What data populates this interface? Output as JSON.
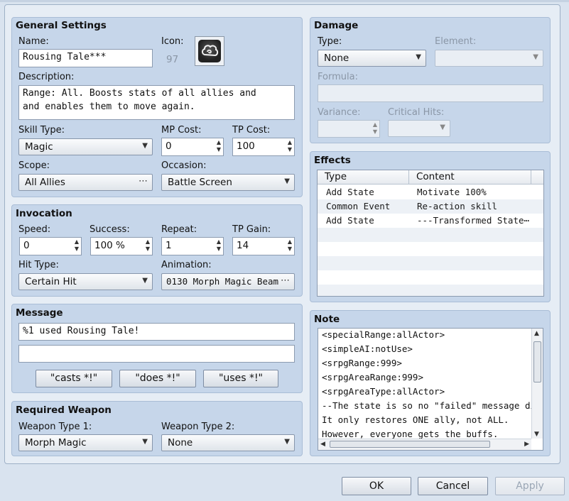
{
  "general": {
    "title": "General Settings",
    "name_label": "Name:",
    "name_value": "Rousing Tale***",
    "icon_label": "Icon:",
    "icon_index": "97",
    "icon_name": "swirl-cloud-icon",
    "description_label": "Description:",
    "description_line1": "Range: All. Boosts stats of all allies and",
    "description_line2": "and enables them to move again.",
    "skill_type_label": "Skill Type:",
    "skill_type_value": "Magic",
    "mp_cost_label": "MP Cost:",
    "mp_cost_value": "0",
    "tp_cost_label": "TP Cost:",
    "tp_cost_value": "100",
    "scope_label": "Scope:",
    "scope_value": "All Allies",
    "occasion_label": "Occasion:",
    "occasion_value": "Battle Screen"
  },
  "invocation": {
    "title": "Invocation",
    "speed_label": "Speed:",
    "speed_value": "0",
    "success_label": "Success:",
    "success_value": "100 %",
    "repeat_label": "Repeat:",
    "repeat_value": "1",
    "tp_gain_label": "TP Gain:",
    "tp_gain_value": "14",
    "hit_type_label": "Hit Type:",
    "hit_type_value": "Certain Hit",
    "animation_label": "Animation:",
    "animation_value": "0130 Morph Magic Beam"
  },
  "message": {
    "title": "Message",
    "line1": "%1 used Rousing Tale!",
    "line2": "",
    "btn_casts": "\"casts *!\"",
    "btn_does": "\"does *!\"",
    "btn_uses": "\"uses *!\""
  },
  "required_weapon": {
    "title": "Required Weapon",
    "type1_label": "Weapon Type 1:",
    "type1_value": "Morph Magic",
    "type2_label": "Weapon Type 2:",
    "type2_value": "None"
  },
  "damage": {
    "title": "Damage",
    "type_label": "Type:",
    "type_value": "None",
    "element_label": "Element:",
    "element_value": "",
    "formula_label": "Formula:",
    "formula_value": "",
    "variance_label": "Variance:",
    "variance_value": "",
    "critical_label": "Critical Hits:",
    "critical_value": ""
  },
  "effects": {
    "title": "Effects",
    "col_type": "Type",
    "col_content": "Content",
    "rows": [
      {
        "type": "Add State",
        "content": "Motivate 100%"
      },
      {
        "type": "Common Event",
        "content": "Re-action skill"
      },
      {
        "type": "Add State",
        "content": "---Transformed State⋯"
      }
    ]
  },
  "note": {
    "title": "Note",
    "lines": [
      "<specialRange:allActor>",
      "<simpleAI:notUse>",
      "<srpgRange:999>",
      "<srpgAreaRange:999>",
      "<srpgAreaType:allActor>",
      "--The state is so no \"failed\" message disp",
      "It only restores ONE ally, not ALL.",
      "However, everyone gets the buffs."
    ]
  },
  "footer": {
    "ok": "OK",
    "cancel": "Cancel",
    "apply": "Apply"
  }
}
